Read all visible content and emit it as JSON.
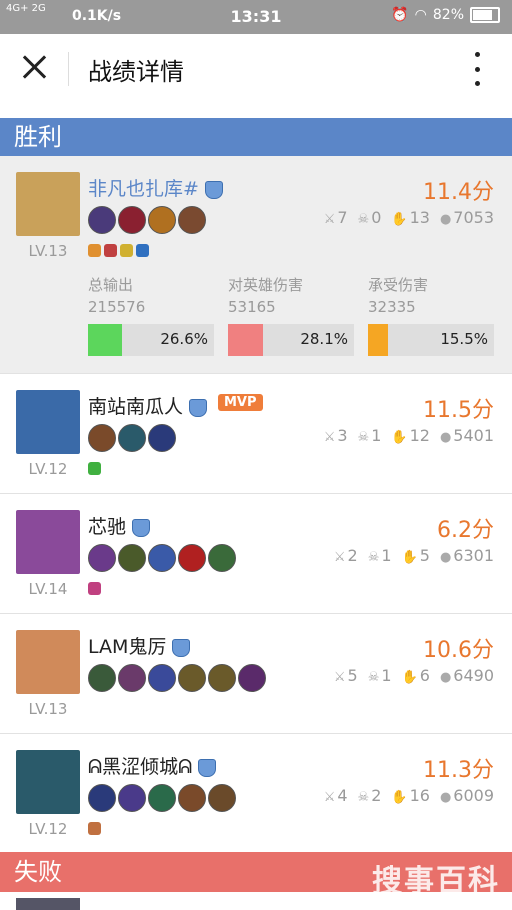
{
  "status": {
    "signal": "4G+ 2G",
    "speed": "0.1K/s",
    "time": "13:31",
    "battery": "82%"
  },
  "header": {
    "title": "战绩详情"
  },
  "sections": {
    "win": "胜利",
    "lose": "失败"
  },
  "players": [
    {
      "name": "非凡也扎库#",
      "level": "LV.13",
      "score": "11.4分",
      "kills": "7",
      "deaths": "0",
      "assists": "13",
      "gold": "7053",
      "mvp": "",
      "avatar_color": "#c9a15a",
      "items": [
        "#4a3a7a",
        "#8a2030",
        "#b07020",
        "#7a4a30"
      ],
      "buffs": [
        "#e09030",
        "#c04040",
        "#d0b030",
        "#3070c0"
      ],
      "stats": [
        {
          "label": "总输出",
          "value": "215576",
          "percent": "26.6%",
          "fraction": 0.266,
          "color": "#5cd65c"
        },
        {
          "label": "对英雄伤害",
          "value": "53165",
          "percent": "28.1%",
          "fraction": 0.281,
          "color": "#f08080"
        },
        {
          "label": "承受伤害",
          "value": "32335",
          "percent": "15.5%",
          "fraction": 0.155,
          "color": "#f5a623"
        }
      ]
    },
    {
      "name": "南站南瓜人",
      "level": "LV.12",
      "score": "11.5分",
      "kills": "3",
      "deaths": "1",
      "assists": "12",
      "gold": "5401",
      "mvp": "MVP",
      "avatar_color": "#3a6aa8",
      "items": [
        "#7a4a2a",
        "#2a5a6a",
        "#2a3a7a"
      ],
      "buffs": [
        "#40b040"
      ]
    },
    {
      "name": "芯驰",
      "level": "LV.14",
      "score": "6.2分",
      "kills": "2",
      "deaths": "1",
      "assists": "5",
      "gold": "6301",
      "mvp": "",
      "avatar_color": "#8a4a9a",
      "items": [
        "#6a3a8a",
        "#4a5a2a",
        "#3a5aa8",
        "#b02020",
        "#3a6a3a"
      ],
      "buffs": [
        "#c04080"
      ]
    },
    {
      "name": "LAM鬼厉",
      "level": "LV.13",
      "score": "10.6分",
      "kills": "5",
      "deaths": "1",
      "assists": "6",
      "gold": "6490",
      "mvp": "",
      "avatar_color": "#d08a5a",
      "items": [
        "#3a5a3a",
        "#6a3a6a",
        "#3a4a9a",
        "#6a5a2a",
        "#6a5a2a",
        "#5a2a6a"
      ],
      "buffs": []
    },
    {
      "name": "黑涩倾城",
      "name_prefix": "ᕱ",
      "name_suffix": "ᕱ",
      "level": "LV.12",
      "score": "11.3分",
      "kills": "4",
      "deaths": "2",
      "assists": "16",
      "gold": "6009",
      "mvp": "",
      "avatar_color": "#2a5a6a",
      "items": [
        "#2a3a7a",
        "#4a3a8a",
        "#2a6a4a",
        "#7a4a2a",
        "#6a4a2a"
      ],
      "buffs": [
        "#c07040"
      ]
    }
  ],
  "icons": {
    "close": "close-icon",
    "more": "more-vertical-icon",
    "kill": "sword-icon",
    "death": "skull-icon",
    "assist": "hand-icon",
    "gold": "coin-icon",
    "shield": "rank-shield-icon"
  },
  "watermark": "搜事百科"
}
